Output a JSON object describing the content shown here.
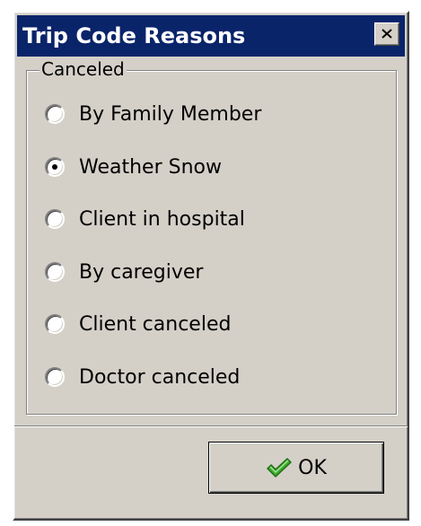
{
  "window": {
    "title": "Trip Code Reasons",
    "title_bar_color": "#0a246a",
    "close_icon": "close-icon"
  },
  "group": {
    "label": "Canceled",
    "options": [
      {
        "label": "By Family Member",
        "checked": false
      },
      {
        "label": "Weather Snow",
        "checked": true
      },
      {
        "label": "Client in hospital",
        "checked": false
      },
      {
        "label": "By caregiver",
        "checked": false
      },
      {
        "label": "Client canceled",
        "checked": false
      },
      {
        "label": "Doctor canceled",
        "checked": false
      }
    ]
  },
  "ok_button": {
    "label": "OK",
    "icon": "checkmark-icon",
    "icon_color": "#3caa2a"
  }
}
